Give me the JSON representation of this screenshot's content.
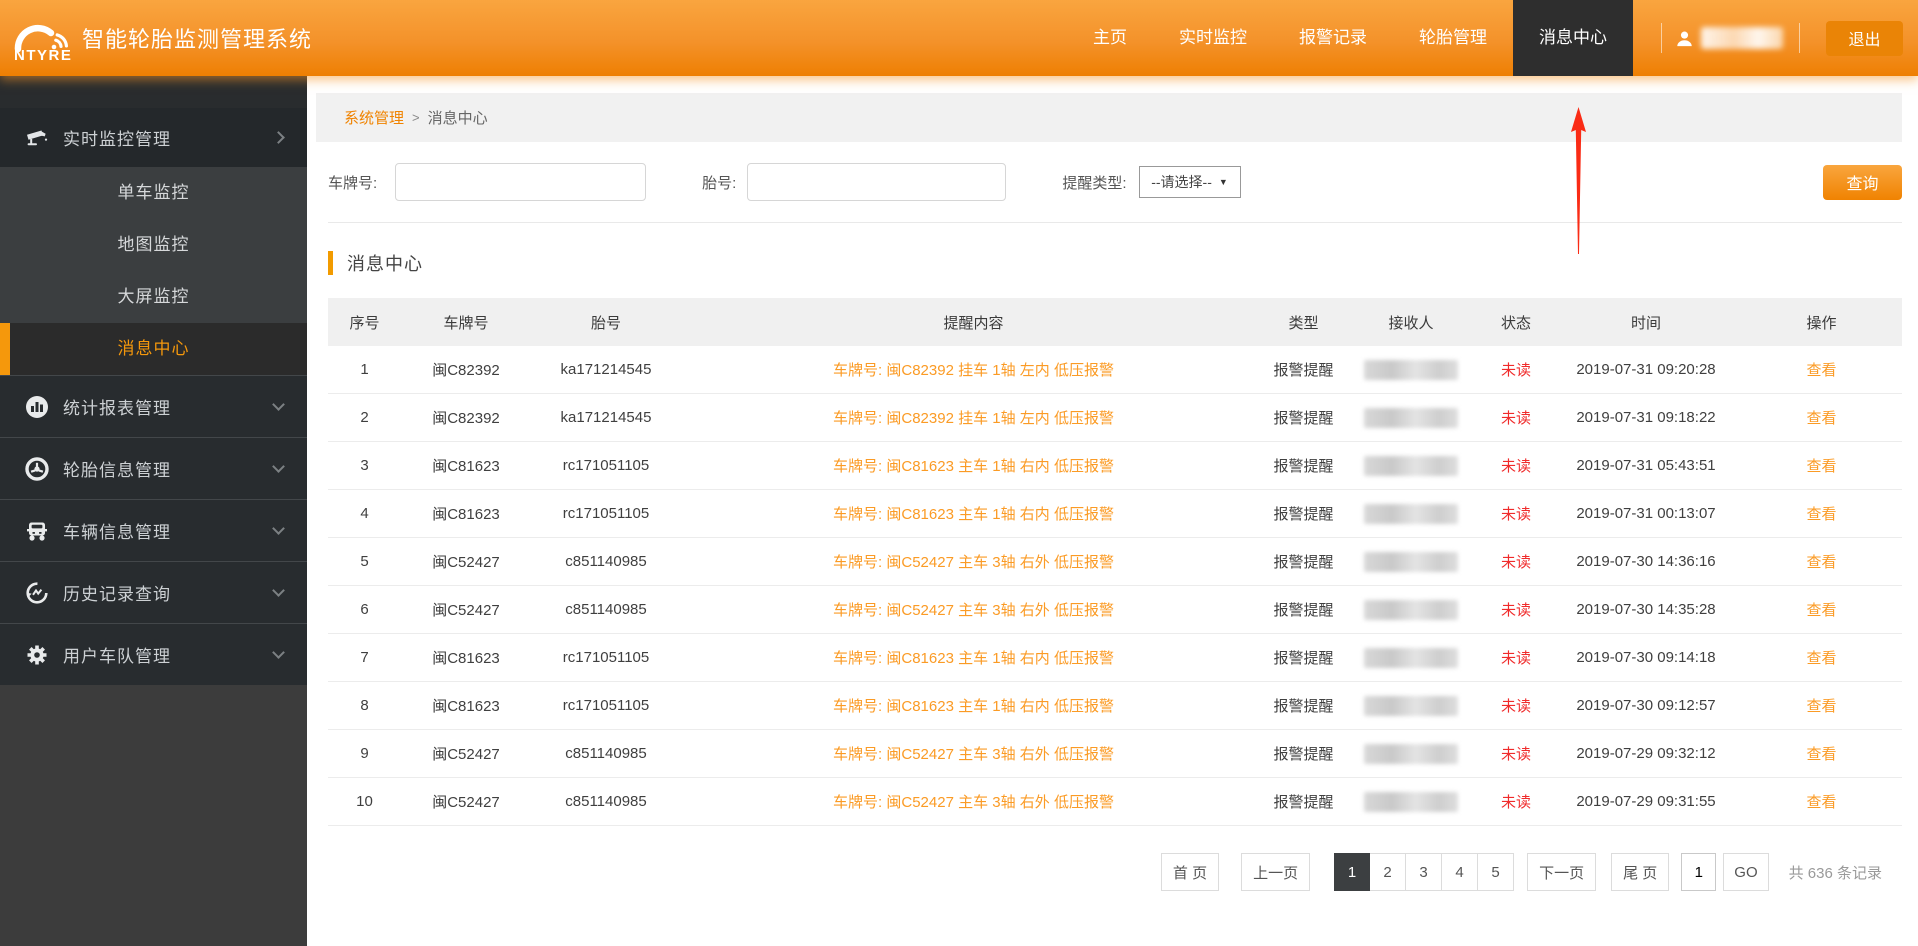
{
  "brand": {
    "logo": "NTYRE",
    "title": "智能轮胎监测管理系统"
  },
  "topnav": {
    "items": [
      {
        "label": "主页",
        "active": false
      },
      {
        "label": "实时监控",
        "active": false
      },
      {
        "label": "报警记录",
        "active": false
      },
      {
        "label": "轮胎管理",
        "active": false
      },
      {
        "label": "消息中心",
        "active": true
      }
    ],
    "logout_label": "退出"
  },
  "sidebar": {
    "expanded_group": {
      "label": "实时监控管理",
      "icon": "camera-icon"
    },
    "submenu": [
      {
        "label": "单车监控",
        "active": false
      },
      {
        "label": "地图监控",
        "active": false
      },
      {
        "label": "大屏监控",
        "active": false
      },
      {
        "label": "消息中心",
        "active": true
      }
    ],
    "groups": [
      {
        "label": "统计报表管理",
        "icon": "chart-icon"
      },
      {
        "label": "轮胎信息管理",
        "icon": "tire-icon"
      },
      {
        "label": "车辆信息管理",
        "icon": "truck-icon"
      },
      {
        "label": "历史记录查询",
        "icon": "history-icon"
      },
      {
        "label": "用户车队管理",
        "icon": "gear-icon"
      }
    ]
  },
  "breadcrumb": {
    "parent": "系统管理",
    "separator": ">",
    "current": "消息中心"
  },
  "filters": {
    "plate_label": "车牌号:",
    "tire_label": "胎号:",
    "type_label": "提醒类型:",
    "type_value": "--请选择--",
    "search_label": "查询"
  },
  "section": {
    "title": "消息中心"
  },
  "table": {
    "columns": [
      "序号",
      "车牌号",
      "胎号",
      "提醒内容",
      "类型",
      "接收人",
      "状态",
      "时间",
      "操作"
    ],
    "rows": [
      {
        "no": "1",
        "plate": "闽C82392",
        "tire": "ka171214545",
        "content": "车牌号: 闽C82392 挂车 1轴 左内 低压报警",
        "type": "报警提醒",
        "status": "未读",
        "time": "2019-07-31 09:20:28",
        "action": "查看"
      },
      {
        "no": "2",
        "plate": "闽C82392",
        "tire": "ka171214545",
        "content": "车牌号: 闽C82392 挂车 1轴 左内 低压报警",
        "type": "报警提醒",
        "status": "未读",
        "time": "2019-07-31 09:18:22",
        "action": "查看"
      },
      {
        "no": "3",
        "plate": "闽C81623",
        "tire": "rc171051105",
        "content": "车牌号: 闽C81623 主车 1轴 右内 低压报警",
        "type": "报警提醒",
        "status": "未读",
        "time": "2019-07-31 05:43:51",
        "action": "查看"
      },
      {
        "no": "4",
        "plate": "闽C81623",
        "tire": "rc171051105",
        "content": "车牌号: 闽C81623 主车 1轴 右内 低压报警",
        "type": "报警提醒",
        "status": "未读",
        "time": "2019-07-31 00:13:07",
        "action": "查看"
      },
      {
        "no": "5",
        "plate": "闽C52427",
        "tire": "c851140985",
        "content": "车牌号: 闽C52427 主车 3轴 右外 低压报警",
        "type": "报警提醒",
        "status": "未读",
        "time": "2019-07-30 14:36:16",
        "action": "查看"
      },
      {
        "no": "6",
        "plate": "闽C52427",
        "tire": "c851140985",
        "content": "车牌号: 闽C52427 主车 3轴 右外 低压报警",
        "type": "报警提醒",
        "status": "未读",
        "time": "2019-07-30 14:35:28",
        "action": "查看"
      },
      {
        "no": "7",
        "plate": "闽C81623",
        "tire": "rc171051105",
        "content": "车牌号: 闽C81623 主车 1轴 右内 低压报警",
        "type": "报警提醒",
        "status": "未读",
        "time": "2019-07-30 09:14:18",
        "action": "查看"
      },
      {
        "no": "8",
        "plate": "闽C81623",
        "tire": "rc171051105",
        "content": "车牌号: 闽C81623 主车 1轴 右内 低压报警",
        "type": "报警提醒",
        "status": "未读",
        "time": "2019-07-30 09:12:57",
        "action": "查看"
      },
      {
        "no": "9",
        "plate": "闽C52427",
        "tire": "c851140985",
        "content": "车牌号: 闽C52427 主车 3轴 右外 低压报警",
        "type": "报警提醒",
        "status": "未读",
        "time": "2019-07-29 09:32:12",
        "action": "查看"
      },
      {
        "no": "10",
        "plate": "闽C52427",
        "tire": "c851140985",
        "content": "车牌号: 闽C52427 主车 3轴 右外 低压报警",
        "type": "报警提醒",
        "status": "未读",
        "time": "2019-07-29 09:31:55",
        "action": "查看"
      }
    ]
  },
  "pagination": {
    "first": "首 页",
    "prev": "上一页",
    "pages": [
      {
        "label": "1",
        "active": true
      },
      {
        "label": "2",
        "active": false
      },
      {
        "label": "3",
        "active": false
      },
      {
        "label": "4",
        "active": false
      },
      {
        "label": "5",
        "active": false
      }
    ],
    "next": "下一页",
    "last": "尾 页",
    "goto_value": "1",
    "go_label": "GO",
    "total": "共 636 条记录"
  }
}
